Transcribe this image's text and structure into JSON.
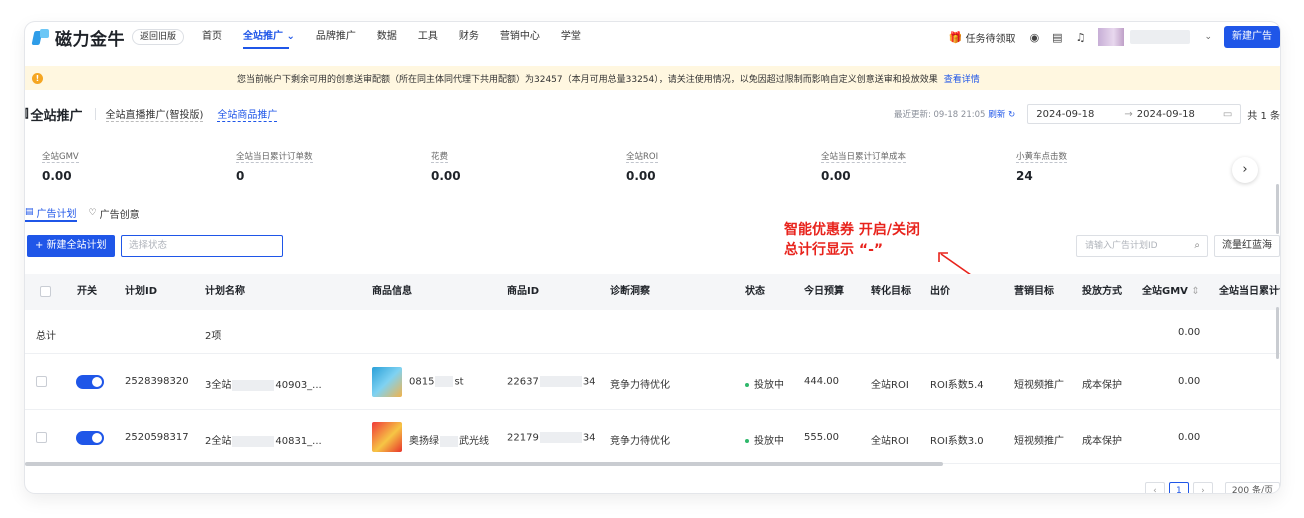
{
  "header": {
    "brand": "磁力金牛",
    "old_version": "返回旧版",
    "nav": [
      "首页",
      "全站推广",
      "品牌推广",
      "数据",
      "工具",
      "财务",
      "营销中心",
      "学堂"
    ],
    "nav_active_suffix": "⌄",
    "task": "任务待领取",
    "new_ad": "新建广告"
  },
  "notice": {
    "text": "您当前帐户下剩余可用的创意送审配额（所在同主体同代理下共用配额）为32457（本月可用总量33254），请关注使用情况，以免因超过限制而影响自定义创意送审和投放效果",
    "link": "查看详情"
  },
  "page": {
    "title": "全站推广",
    "sub_tabs": [
      "全站直播推广(智投版)",
      "全站商品推广"
    ],
    "updated": "最近更新: 09-18 21:05",
    "refresh": "刷新",
    "date_start": "2024-09-18",
    "date_end": "2024-09-18",
    "total": "共 1 条"
  },
  "metrics": [
    {
      "label": "全站GMV",
      "value": "0.00"
    },
    {
      "label": "全站当日累计订单数",
      "value": "0"
    },
    {
      "label": "花费",
      "value": "0.00"
    },
    {
      "label": "全站ROI",
      "value": "0.00"
    },
    {
      "label": "全站当日累计订单成本",
      "value": "0.00"
    },
    {
      "label": "小黄车点击数",
      "value": "24"
    }
  ],
  "plan_tabs": [
    "广告计划",
    "广告创意"
  ],
  "toolbar": {
    "new_plan": "+ 新建全站计划",
    "state_placeholder": "选择状态",
    "search_placeholder": "请输入广告计划ID",
    "traffic": "流量红蓝海"
  },
  "annotation": {
    "line1": "智能优惠券  开启/关闭",
    "line2": "总计行显示 “-”"
  },
  "table": {
    "headers": [
      "开关",
      "计划ID",
      "计划名称",
      "商品信息",
      "商品ID",
      "诊断洞察",
      "状态",
      "今日预算",
      "转化目标",
      "出价",
      "营销目标",
      "投放方式",
      "全站GMV",
      "全站当日累计订"
    ],
    "sort_icon": "⇕",
    "total_row": {
      "label": "总计",
      "name": "2项",
      "gmv": "0.00"
    },
    "rows": [
      {
        "plan_id": "2528398320",
        "name_prefix": "3全站",
        "name_suffix": "40903_...",
        "product_prefix": "0815",
        "product_suffix": "st",
        "product_id_prefix": "22637",
        "product_id_suffix": "34",
        "diagnosis": "竞争力待优化",
        "status": "投放中",
        "budget": "444.00",
        "target": "全站ROI",
        "bid": "ROI系数5.4",
        "goal": "短视频推广",
        "method": "成本保护",
        "gmv": "0.00"
      },
      {
        "plan_id": "2520598317",
        "name_prefix": "2全站",
        "name_suffix": "40831_...",
        "product_prefix": "奥扬绿",
        "product_suffix": "武光线",
        "product_id_prefix": "22179",
        "product_id_suffix": "34",
        "diagnosis": "竞争力待优化",
        "status": "投放中",
        "budget": "555.00",
        "target": "全站ROI",
        "bid": "ROI系数3.0",
        "goal": "短视频推广",
        "method": "成本保护",
        "gmv": "0.00"
      }
    ]
  },
  "pager": {
    "current": "1",
    "size": "200 条/页"
  }
}
